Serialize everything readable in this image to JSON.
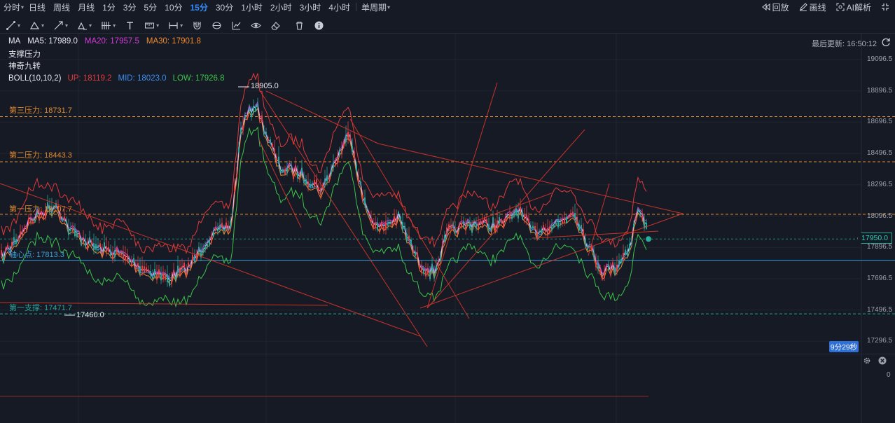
{
  "timeframes": [
    {
      "label": "分时",
      "dropdown": true
    },
    {
      "label": "日线"
    },
    {
      "label": "周线"
    },
    {
      "label": "月线"
    },
    {
      "label": "1分"
    },
    {
      "label": "3分"
    },
    {
      "label": "5分"
    },
    {
      "label": "10分"
    },
    {
      "label": "15分",
      "active": true
    },
    {
      "label": "30分"
    },
    {
      "label": "1小时"
    },
    {
      "label": "2小时"
    },
    {
      "label": "3小时"
    },
    {
      "label": "4小时"
    }
  ],
  "period_select": "单周期",
  "top_right": {
    "replay": "回放",
    "draw": "画线",
    "ai": "AI解析"
  },
  "legend": {
    "ma": "MA",
    "ma5": "MA5: 17989.0",
    "ma20": "MA20: 17957.5",
    "ma30": "MA30: 17901.8"
  },
  "indicators": {
    "support_resistance": "支撑压力",
    "magic_nine": "神奇九转",
    "boll_name": "BOLL(10,10,2)",
    "boll_up": "UP: 18119.2",
    "boll_mid": "MID: 18023.0",
    "boll_low": "LOW: 17926.8"
  },
  "last_update": "最后更新: 16:50:12",
  "price_axis": [
    "19096.5",
    "18896.5",
    "18696.5",
    "18496.5",
    "18296.5",
    "18096.5",
    "17896.5",
    "17696.5",
    "17496.5",
    "17296.5"
  ],
  "current_price": "17950.0",
  "countdown": "9分29秒",
  "levels": {
    "r3": "第三压力: 18731.7",
    "r2": "第二压力: 18443.3",
    "r1": "第一压力: 18107.7",
    "pivot": "轴心点: 17813.3",
    "s1": "第一支撑: 17471.7"
  },
  "annotations": {
    "high": "18905.0",
    "low": "17460.0"
  },
  "sub_axis_zero": "0",
  "colors": {
    "bg": "#161a25",
    "ma5": "#e8e8e8",
    "ma20": "#d03cd8",
    "ma30": "#f08a2c",
    "boll_up": "#e03b3b",
    "boll_mid": "#3a8ef0",
    "boll_low": "#3cc34a",
    "up_candle": "#e04343",
    "down_candle": "#26a69a",
    "accent": "#2f8cff",
    "pressure": "#e08a2c",
    "support": "#26a69a",
    "pivot": "#3aa0d8"
  }
}
